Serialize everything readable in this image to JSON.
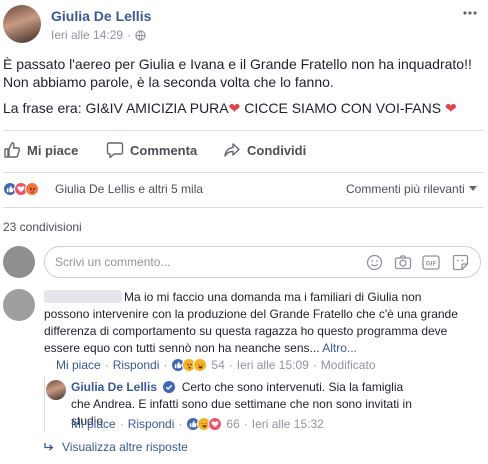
{
  "post": {
    "author": "Giulia De Lellis",
    "timestamp": "Ieri alle 14:29",
    "visibility_sep": "·",
    "more_icon": "ellipsis-icon",
    "text_line1": "È passato l'aereo per Giulia e Ivana e il Grande Fratello non ha inquadrato!!",
    "text_line2": "Non abbiamo parole, è la seconda volta che lo fanno.",
    "text_line3a": "La frase era: GI&IV AMICIZIA PURA",
    "text_line3b": " CICCE SIAMO CON VOI-FANS ",
    "heart_glyph": "❤"
  },
  "actions": {
    "like": "Mi piace",
    "comment": "Commenta",
    "share": "Condividi"
  },
  "reactions": {
    "summary": "Giulia De Lellis e altri 5 mila",
    "sort": "Commenti più rilevanti",
    "shares": "23 condivisioni"
  },
  "composer": {
    "placeholder": "Scrivi un commento..."
  },
  "comment1": {
    "author": "",
    "text": "Ma io mi faccio una domanda ma i familiari di Giulia non possono intervenire con la produzione del Grande Fratello che c'è una grande differenza di comportamento su questa ragazza ho questo programma deve essere equo con tutti sennò non ha neanche sens...",
    "more": "Altro...",
    "like": "Mi piace",
    "reply": "Rispondi",
    "count": "54",
    "time": "Ieri alle 15:09",
    "edited": "Modificato",
    "dot": "·"
  },
  "reply1": {
    "author": "Giulia De Lellis",
    "text": "Certo che sono intervenuti. Sia la famiglia che Andrea. E infatti sono due settimane che non sono invitati in studio",
    "like": "Mi piace",
    "reply": "Rispondi",
    "count": "66",
    "time": "Ieri alle 15:32",
    "dot": "·"
  },
  "more_replies": "Visualizza altre risposte",
  "colors": {
    "link_blue": "#385898",
    "fb_blue": "#4267b2",
    "heart_red": "#e2434b",
    "gray_text": "#90949c"
  }
}
